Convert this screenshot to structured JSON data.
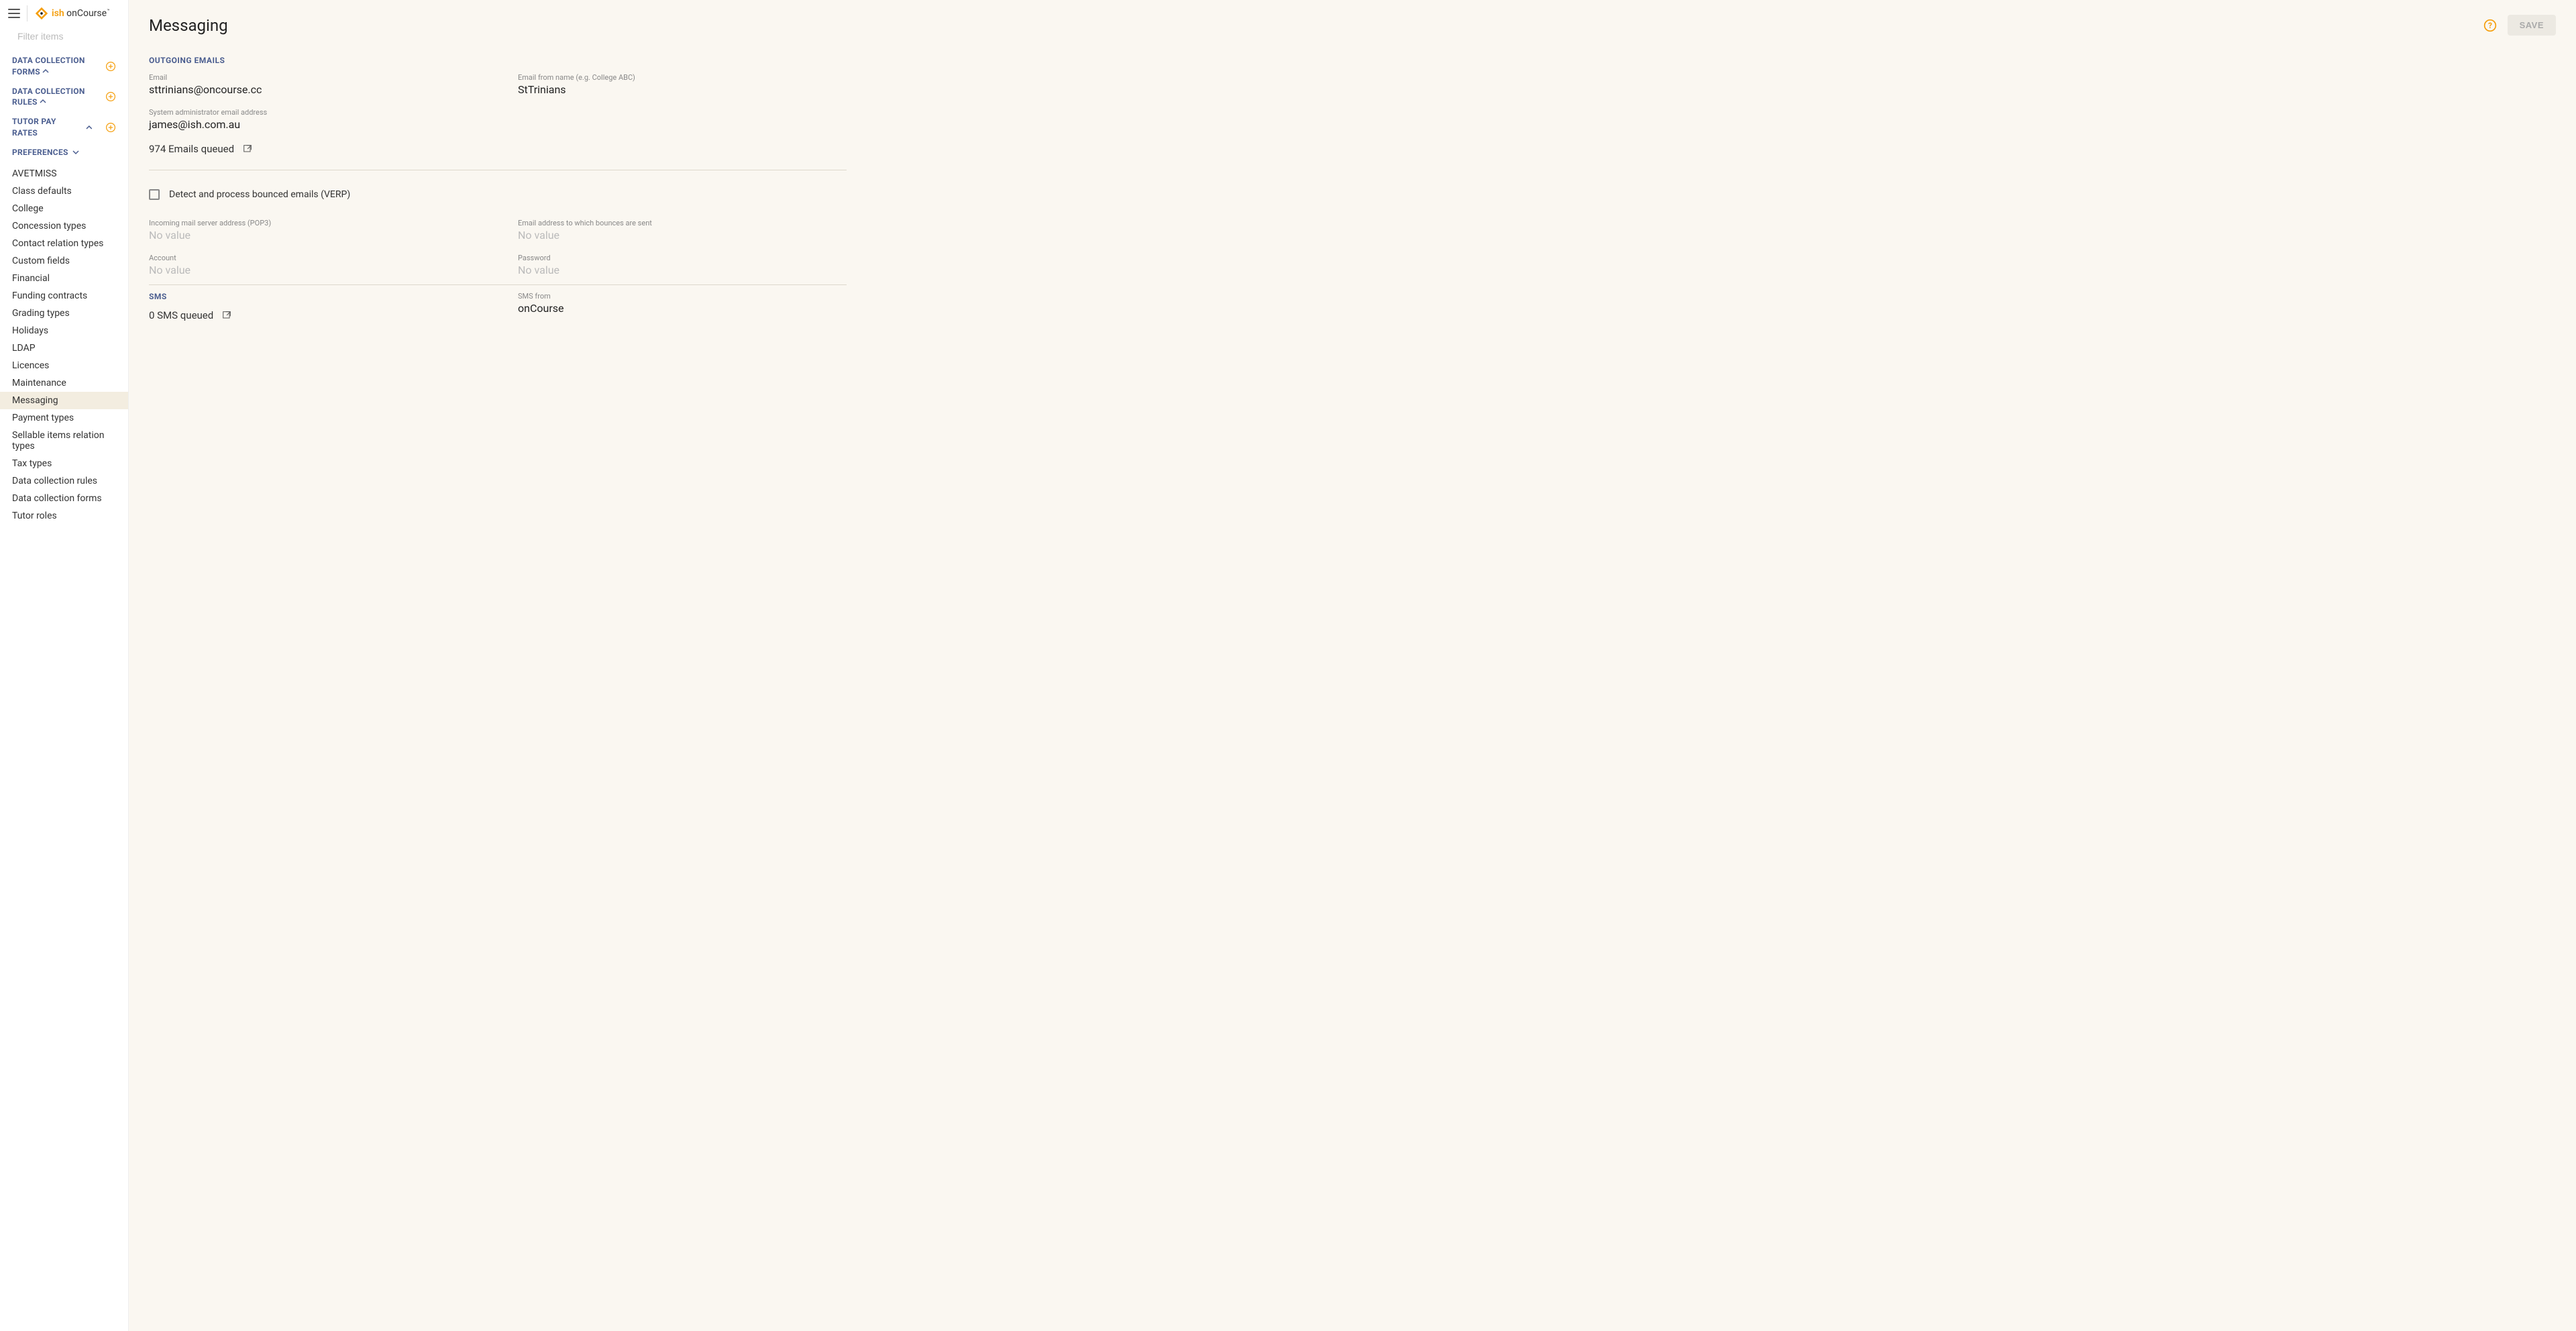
{
  "brand": {
    "ish": "ish",
    "rest": " onCourse"
  },
  "search": {
    "placeholder": "Filter items"
  },
  "nav": {
    "groups": [
      {
        "title": "DATA COLLECTION FORMS",
        "collapsed": false,
        "add": true
      },
      {
        "title": "DATA COLLECTION RULES",
        "collapsed": false,
        "add": true
      },
      {
        "title": "TUTOR PAY RATES",
        "collapsed": false,
        "add": true
      },
      {
        "title": "PREFERENCES",
        "collapsed": true,
        "add": false
      }
    ],
    "preferences_items": [
      "AVETMISS",
      "Class defaults",
      "College",
      "Concession types",
      "Contact relation types",
      "Custom fields",
      "Financial",
      "Funding contracts",
      "Grading types",
      "Holidays",
      "LDAP",
      "Licences",
      "Maintenance",
      "Messaging",
      "Payment types",
      "Sellable items relation types",
      "Tax types",
      "Data collection rules",
      "Data collection forms",
      "Tutor roles"
    ],
    "active_item": "Messaging"
  },
  "header": {
    "title": "Messaging",
    "save_label": "SAVE"
  },
  "outgoing": {
    "heading": "OUTGOING EMAILS",
    "email_label": "Email",
    "email_value": "sttrinians@oncourse.cc",
    "from_name_label": "Email from name (e.g. College ABC)",
    "from_name_value": "StTrinians",
    "admin_label": "System administrator email address",
    "admin_value": "james@ish.com.au",
    "queued_text": "974 Emails queued"
  },
  "bounce": {
    "checkbox_label": "Detect and process bounced emails (VERP)",
    "pop3_label": "Incoming mail server address (POP3)",
    "pop3_value": "No value",
    "bounce_addr_label": "Email address to which bounces are sent",
    "bounce_addr_value": "No value",
    "account_label": "Account",
    "account_value": "No value",
    "password_label": "Password",
    "password_value": "No value"
  },
  "sms": {
    "heading": "SMS",
    "queued_text": "0 SMS queued",
    "from_label": "SMS from",
    "from_value": "onCourse"
  }
}
